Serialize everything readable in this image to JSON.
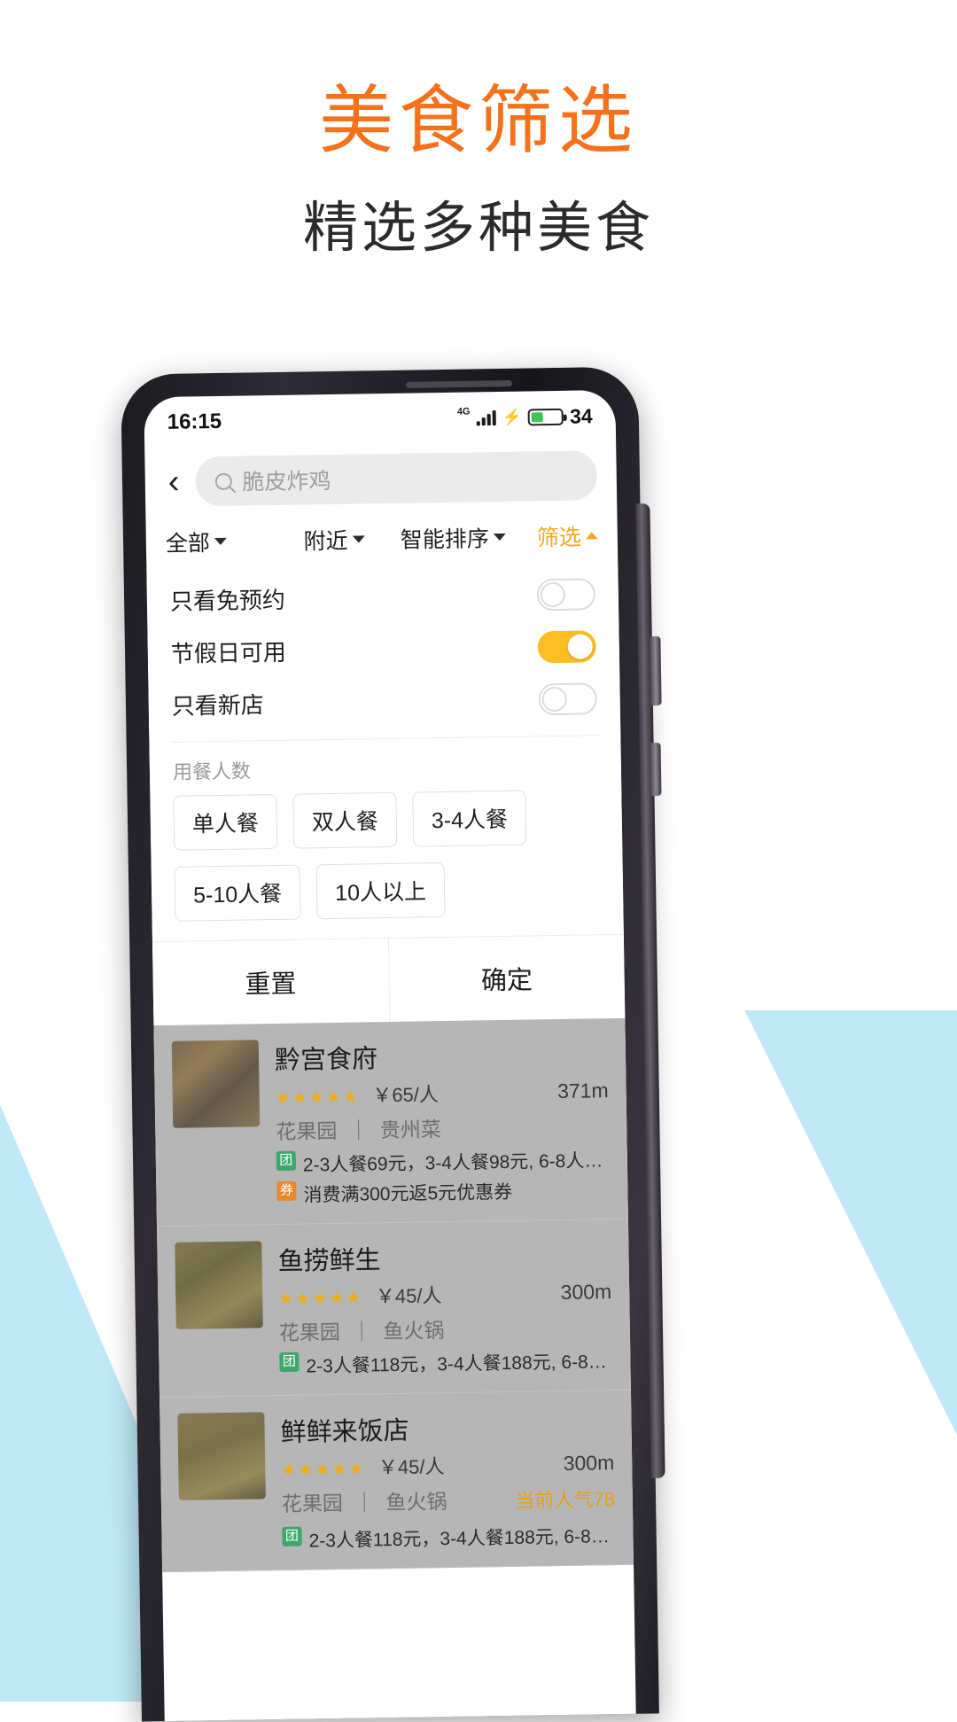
{
  "hero": {
    "title": "美食筛选",
    "subtitle": "精选多种美食",
    "title_color": "#f5711c"
  },
  "status_bar": {
    "time": "16:15",
    "network": "4G",
    "battery_percent": "34"
  },
  "search": {
    "back_icon": "chevron-left-icon",
    "search_icon": "search-icon",
    "placeholder": "脆皮炸鸡"
  },
  "filter_tabs": [
    {
      "label": "全部",
      "icon": "chevron-down-icon",
      "active": false
    },
    {
      "label": "附近",
      "icon": "chevron-down-icon",
      "active": false
    },
    {
      "label": "智能排序",
      "icon": "chevron-down-icon",
      "active": false
    },
    {
      "label": "筛选",
      "icon": "chevron-up-icon",
      "active": true
    }
  ],
  "filter_panel": {
    "toggles": [
      {
        "label": "只看免预约",
        "on": false
      },
      {
        "label": "节假日可用",
        "on": true
      },
      {
        "label": "只看新店",
        "on": false
      }
    ],
    "group_label": "用餐人数",
    "chips": [
      "单人餐",
      "双人餐",
      "3-4人餐",
      "5-10人餐",
      "10人以上"
    ],
    "reset_label": "重置",
    "confirm_label": "确定"
  },
  "results": [
    {
      "name": "黔宫食府",
      "stars": "★★★★★",
      "price": "￥65/人",
      "distance": "371m",
      "area": "花果园",
      "category": "贵州菜",
      "hot": "",
      "promos": [
        {
          "tag": "团",
          "type": "group",
          "text": "2-3人餐69元，3-4人餐98元, 6-8人餐..."
        },
        {
          "tag": "券",
          "type": "coupon",
          "text": "消费满300元返5元优惠券"
        }
      ]
    },
    {
      "name": "鱼捞鲜生",
      "stars": "★★★★★",
      "price": "￥45/人",
      "distance": "300m",
      "area": "花果园",
      "category": "鱼火锅",
      "hot": "",
      "promos": [
        {
          "tag": "团",
          "type": "group",
          "text": "2-3人餐118元，3-4人餐188元, 6-8人..."
        }
      ]
    },
    {
      "name": "鲜鲜来饭店",
      "stars": "★★★★★",
      "price": "￥45/人",
      "distance": "300m",
      "area": "花果园",
      "category": "鱼火锅",
      "hot": "当前人气78",
      "promos": [
        {
          "tag": "团",
          "type": "group",
          "text": "2-3人餐118元，3-4人餐188元, 6-8人..."
        }
      ]
    }
  ]
}
